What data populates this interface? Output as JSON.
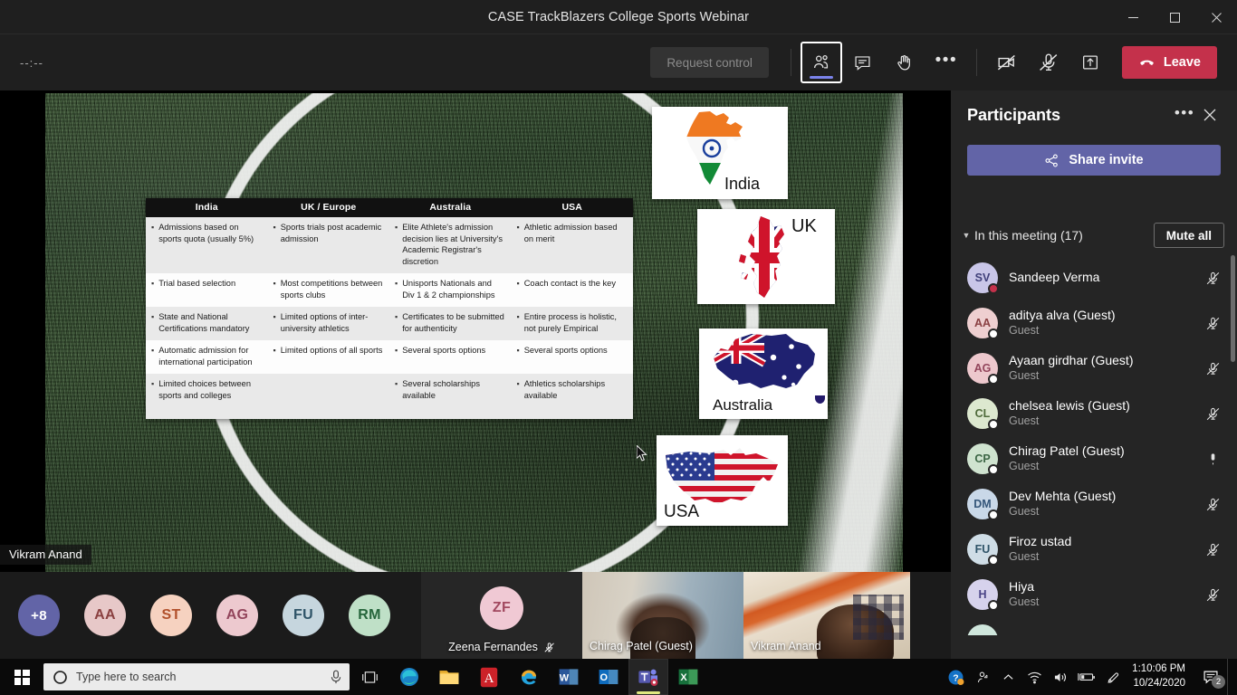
{
  "window": {
    "title": "CASE TrackBlazers College Sports Webinar",
    "minimize_label": "Minimize",
    "maximize_label": "Restore",
    "close_label": "Close"
  },
  "toolbar": {
    "timer": "--:--",
    "request_control_label": "Request control",
    "people_label": "Show participants",
    "chat_label": "Show conversation",
    "raise_hand_label": "Raise your hand",
    "more_label": "More actions",
    "camera_label": "Turn camera on",
    "mic_label": "Unmute",
    "share_label": "Share content",
    "leave_label": "Leave"
  },
  "stage": {
    "presenter_name": "Vikram Anand",
    "slide": {
      "columns": [
        "India",
        "UK / Europe",
        "Australia",
        "USA"
      ],
      "rows": [
        [
          "Admissions based on sports quota (usually 5%)",
          "Sports trials post academic admission",
          "Elite Athlete's admission decision lies at University's Academic Registrar's discretion",
          "Athletic admission based on merit"
        ],
        [
          "Trial based selection",
          "Most competitions between sports clubs",
          "Unisports Nationals and Div 1 & 2 championships",
          "Coach contact is the key"
        ],
        [
          "State and National Certifications mandatory",
          "Limited options of inter-university athletics",
          "Certificates to be submitted for authenticity",
          "Entire process is holistic, not purely Empirical"
        ],
        [
          "Automatic admission for international participation",
          "Limited options of all sports",
          "Several sports options",
          "Several sports options"
        ],
        [
          "Limited choices between sports and colleges",
          "",
          "Several scholarships available",
          "Athletics scholarships available"
        ]
      ],
      "map_cards": [
        {
          "label": "India",
          "icon": "india-map-flag-icon"
        },
        {
          "label": "UK",
          "icon": "uk-map-flag-icon"
        },
        {
          "label": "Australia",
          "icon": "australia-map-flag-icon"
        },
        {
          "label": "USA",
          "icon": "usa-map-flag-icon"
        }
      ]
    }
  },
  "filmstrip": {
    "overflow_count": "+8",
    "avatars": [
      {
        "initials": "AA",
        "bg": "#e7c8c8",
        "fg": "#8a4040"
      },
      {
        "initials": "ST",
        "bg": "#f6d2c0",
        "fg": "#b1502a"
      },
      {
        "initials": "AG",
        "bg": "#edc9cf",
        "fg": "#93465c"
      },
      {
        "initials": "FU",
        "bg": "#c6d6de",
        "fg": "#2f5468"
      },
      {
        "initials": "RM",
        "bg": "#bfe0c7",
        "fg": "#26663c"
      }
    ],
    "tiles": [
      {
        "name": "Zeena Fernandes",
        "initials": "ZF",
        "bg": "#f0c9d4",
        "fg": "#a1485f",
        "type": "avatar",
        "muted": true
      },
      {
        "name": "Chirag Patel (Guest)",
        "type": "video",
        "muted": false
      },
      {
        "name": "Vikram Anand",
        "type": "video",
        "muted": false
      }
    ]
  },
  "panel": {
    "title": "Participants",
    "more_label": "More options",
    "close_label": "Close",
    "share_invite_label": "Share invite",
    "section_label": "In this meeting (17)",
    "mute_all_label": "Mute all",
    "participants": [
      {
        "name": "Sandeep Verma",
        "role": "",
        "initials": "SV",
        "bg": "#c9c6e8",
        "fg": "#40407a",
        "presence": "busy",
        "muted": true
      },
      {
        "name": "aditya alva (Guest)",
        "role": "Guest",
        "initials": "AA",
        "bg": "#eecfd0",
        "fg": "#8a4042",
        "presence": "unknown",
        "muted": true
      },
      {
        "name": "Ayaan girdhar (Guest)",
        "role": "Guest",
        "initials": "AG",
        "bg": "#edc8cd",
        "fg": "#93465c",
        "presence": "unknown",
        "muted": true
      },
      {
        "name": "chelsea lewis (Guest)",
        "role": "Guest",
        "initials": "CL",
        "bg": "#dce8cf",
        "fg": "#4e6a3a",
        "presence": "unknown",
        "muted": true
      },
      {
        "name": "Chirag Patel (Guest)",
        "role": "Guest",
        "initials": "CP",
        "bg": "#cfe3cf",
        "fg": "#3c6645",
        "presence": "unknown",
        "muted": false
      },
      {
        "name": "Dev Mehta (Guest)",
        "role": "Guest",
        "initials": "DM",
        "bg": "#c9d8e8",
        "fg": "#35567a",
        "presence": "unknown",
        "muted": true
      },
      {
        "name": "Firoz ustad",
        "role": "Guest",
        "initials": "FU",
        "bg": "#cfdde6",
        "fg": "#2f5468",
        "presence": "unknown",
        "muted": true
      },
      {
        "name": "Hiya",
        "role": "Guest",
        "initials": "H",
        "bg": "#d6d2ec",
        "fg": "#4a4486",
        "presence": "unknown",
        "muted": true
      },
      {
        "name": "",
        "role": "",
        "initials": "",
        "bg": "#cfe6dc",
        "fg": "#2f6655",
        "presence": "unknown",
        "muted": true
      }
    ]
  },
  "taskbar": {
    "start_label": "Start",
    "search_placeholder": "Type here to search",
    "search_value": "Type here to search",
    "cortana_label": "Cortana",
    "mic_label": "Search with voice",
    "task_view_label": "Task View",
    "apps": [
      {
        "name": "edge-icon",
        "open": true
      },
      {
        "name": "file-explorer-icon",
        "open": true
      },
      {
        "name": "adobe-acrobat-icon",
        "open": true
      },
      {
        "name": "internet-explorer-icon",
        "open": false
      },
      {
        "name": "word-icon",
        "open": true
      },
      {
        "name": "outlook-icon",
        "open": true
      },
      {
        "name": "teams-icon",
        "open": true,
        "active": true
      },
      {
        "name": "excel-icon",
        "open": true
      }
    ],
    "tray": {
      "help_label": "Get Help",
      "people_label": "People",
      "chevron_label": "Show hidden icons",
      "network_label": "Network",
      "volume_label": "Volume",
      "battery_label": "Battery",
      "pen_label": "Windows Ink Workspace",
      "time": "1:10:06 PM",
      "date": "10/24/2020",
      "notification_count": "2"
    }
  },
  "colors": {
    "accent": "#6264a7",
    "leave": "#c4314b",
    "panel_bg": "#252525",
    "toolbar_bg": "#1f1f1f"
  }
}
